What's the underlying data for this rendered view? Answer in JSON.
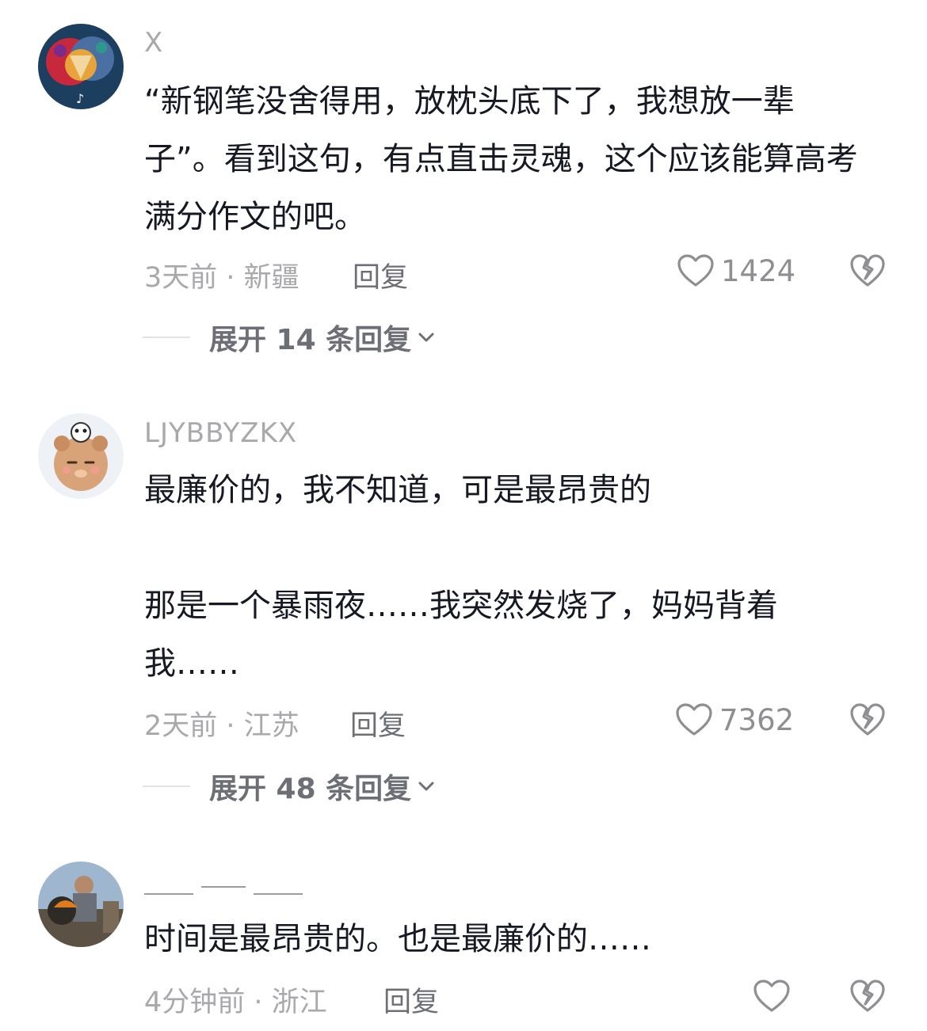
{
  "comments": [
    {
      "username": "X",
      "text": "“新钢笔没舍得用，放枕头底下了，我想放一辈子”。看到这句，有点直击灵魂，这个应该能算高考满分作文的吧。",
      "meta": "3天前 · 新疆",
      "reply_label": "回复",
      "likes": "1424",
      "expand_label": "展开 14 条回复"
    },
    {
      "username": "LJYBBYZKX",
      "text": "最廉价的，我不知道，可是最昂贵的\n\n那是一个暴雨夜……我突然发烧了，妈妈背着我……",
      "meta": "2天前 · 江苏",
      "reply_label": "回复",
      "likes": "7362",
      "expand_label": "展开 48 条回复"
    },
    {
      "username": "",
      "text": "时间是最昂贵的。也是最廉价的……",
      "meta": "4分钟前 · 浙江",
      "reply_label": "回复",
      "likes": ""
    }
  ],
  "icons": {
    "like": "heart-outline-icon",
    "dislike": "broken-heart-icon",
    "expand": "chevron-down-icon"
  },
  "colors": {
    "text": "#161823",
    "secondary": "#a9a9ad",
    "icon": "#8e8e93"
  }
}
